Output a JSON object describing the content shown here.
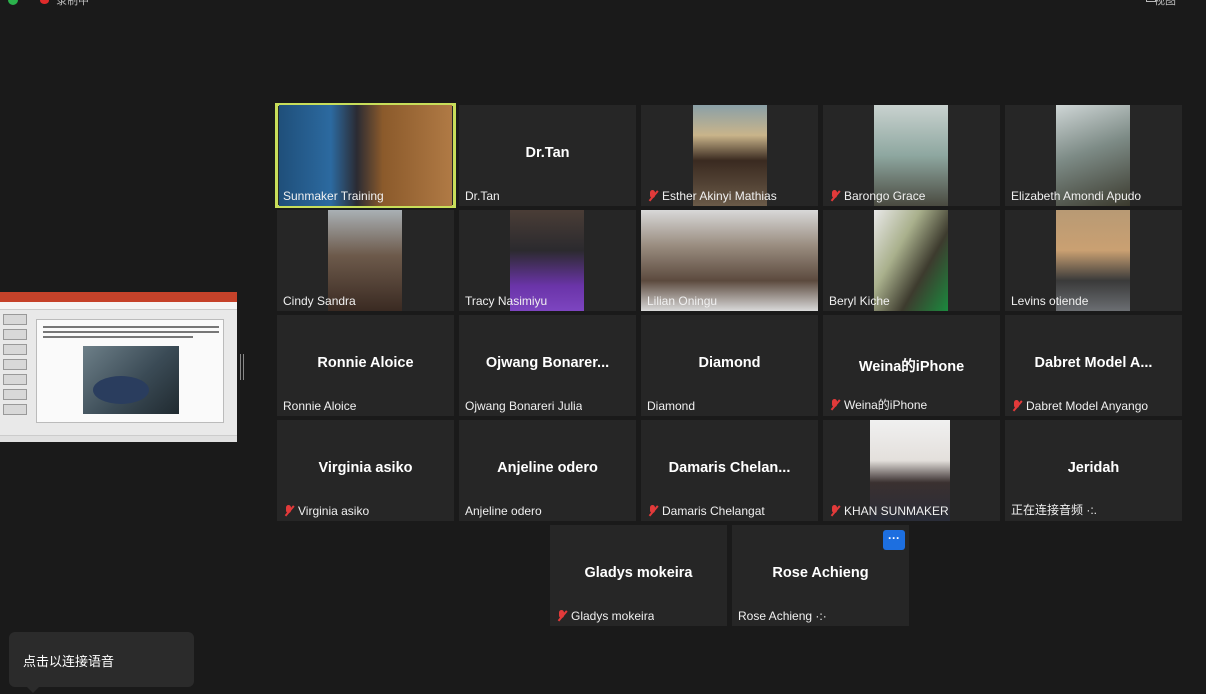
{
  "topbar": {
    "recording_label": "录制中",
    "right_label": "视图"
  },
  "tiles": [
    {
      "id": "sunmaker-training",
      "label": "Sunmaker Training",
      "muted": false,
      "video": "training",
      "active": true
    },
    {
      "id": "dr-tan",
      "label": "Dr.Tan",
      "name": "Dr.Tan",
      "muted": false
    },
    {
      "id": "esther",
      "label": "Esther Akinyi Mathias",
      "muted": true,
      "video": "mask"
    },
    {
      "id": "barongo",
      "label": "Barongo Grace",
      "muted": true,
      "video": "room"
    },
    {
      "id": "elizabeth",
      "label": "Elizabeth Amondi Apudo",
      "muted": false,
      "video": "ceiling"
    },
    {
      "id": "cindy",
      "label": "Cindy Sandra",
      "muted": false,
      "video": "kids"
    },
    {
      "id": "tracy",
      "label": "Tracy Nasimiyu",
      "muted": false,
      "video": "purple"
    },
    {
      "id": "lilian",
      "label": "Lilian Oningu",
      "muted": false,
      "video": "class"
    },
    {
      "id": "beryl",
      "label": "Beryl Kiche",
      "muted": false,
      "video": "window"
    },
    {
      "id": "levins",
      "label": "Levins otiende",
      "muted": false,
      "video": "man"
    },
    {
      "id": "ronnie",
      "label": "Ronnie Aloice",
      "name": "Ronnie Aloice",
      "muted": false
    },
    {
      "id": "ojwang",
      "label": "Ojwang Bonareri Julia",
      "name": "Ojwang  Bonarer...",
      "muted": false
    },
    {
      "id": "diamond",
      "label": "Diamond",
      "name": "Diamond",
      "muted": false
    },
    {
      "id": "weina",
      "label": "Weina的iPhone",
      "name": "Weina的iPhone",
      "muted": true
    },
    {
      "id": "dabret",
      "label": "Dabret Model Anyango",
      "name": "Dabret  Model  A...",
      "muted": true
    },
    {
      "id": "virginia",
      "label": "Virginia asiko",
      "name": "Virginia asiko",
      "muted": true
    },
    {
      "id": "anjeline",
      "label": "Anjeline odero",
      "name": "Anjeline odero",
      "muted": false
    },
    {
      "id": "damaris",
      "label": "Damaris Chelangat",
      "name": "Damaris  Chelan...",
      "muted": true
    },
    {
      "id": "khan",
      "label": "KHAN SUNMAKER",
      "muted": true,
      "video": "portrait"
    },
    {
      "id": "jeridah",
      "label": "正在连接音频 ·:.",
      "name": "Jeridah",
      "muted": false
    },
    {
      "id": "gladys",
      "label": "Gladys mokeira",
      "name": "Gladys mokeira",
      "muted": true
    },
    {
      "id": "rose",
      "label": "Rose Achieng ·:·",
      "name": "Rose Achieng",
      "muted": false
    }
  ],
  "more_button": "···",
  "toast": {
    "text": "点击以连接语音"
  }
}
